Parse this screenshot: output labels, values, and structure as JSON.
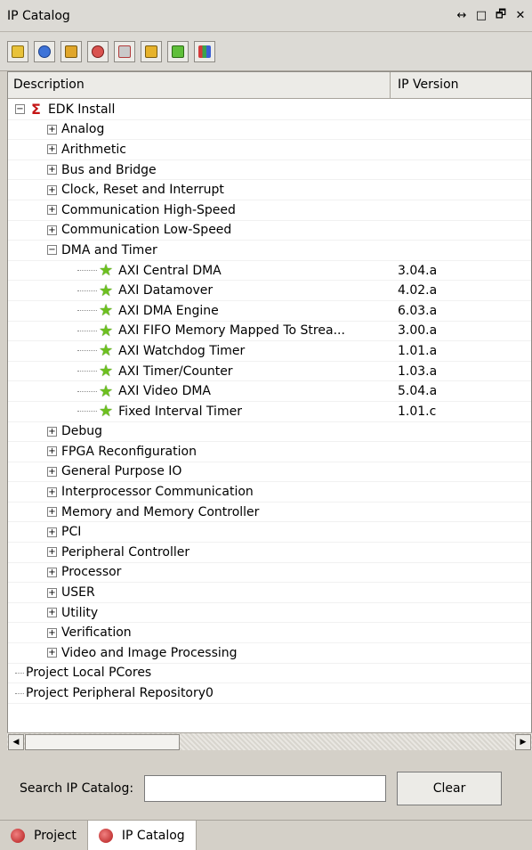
{
  "window": {
    "title": "IP Catalog",
    "controls": [
      "↔",
      "□",
      "🗗",
      "✕"
    ]
  },
  "toolbar": {
    "icons": [
      "tree-icon",
      "add-icon",
      "import-icon",
      "refresh-icon",
      "filter-icon",
      "lock-icon",
      "config-icon",
      "chart-icon"
    ]
  },
  "table": {
    "headers": [
      "Description",
      "IP Version"
    ],
    "rows": [
      {
        "label": "EDK Install",
        "level": 0,
        "exp": "minus",
        "kind": "root",
        "ver": ""
      },
      {
        "label": "Analog",
        "level": 1,
        "exp": "plus",
        "ver": ""
      },
      {
        "label": "Arithmetic",
        "level": 1,
        "exp": "plus",
        "ver": ""
      },
      {
        "label": "Bus and Bridge",
        "level": 1,
        "exp": "plus",
        "ver": ""
      },
      {
        "label": "Clock, Reset and Interrupt",
        "level": 1,
        "exp": "plus",
        "ver": ""
      },
      {
        "label": "Communication High-Speed",
        "level": 1,
        "exp": "plus",
        "ver": ""
      },
      {
        "label": "Communication Low-Speed",
        "level": 1,
        "exp": "plus",
        "ver": ""
      },
      {
        "label": "DMA and Timer",
        "level": 1,
        "exp": "minus",
        "ver": ""
      },
      {
        "label": "AXI Central DMA",
        "level": 2,
        "kind": "star",
        "ver": "3.04.a"
      },
      {
        "label": "AXI Datamover",
        "level": 2,
        "kind": "star",
        "ver": "4.02.a"
      },
      {
        "label": "AXI DMA Engine",
        "level": 2,
        "kind": "star",
        "ver": "6.03.a"
      },
      {
        "label": "AXI FIFO Memory Mapped To Strea...",
        "level": 2,
        "kind": "star",
        "ver": "3.00.a"
      },
      {
        "label": "AXI Watchdog Timer",
        "level": 2,
        "kind": "star",
        "ver": "1.01.a"
      },
      {
        "label": "AXI Timer/Counter",
        "level": 2,
        "kind": "star",
        "ver": "1.03.a"
      },
      {
        "label": "AXI Video DMA",
        "level": 2,
        "kind": "star",
        "ver": "5.04.a"
      },
      {
        "label": "Fixed Interval Timer",
        "level": 2,
        "kind": "star",
        "ver": "1.01.c"
      },
      {
        "label": "Debug",
        "level": 1,
        "exp": "plus",
        "ver": ""
      },
      {
        "label": "FPGA Reconfiguration",
        "level": 1,
        "exp": "plus",
        "ver": ""
      },
      {
        "label": "General Purpose IO",
        "level": 1,
        "exp": "plus",
        "ver": ""
      },
      {
        "label": "Interprocessor Communication",
        "level": 1,
        "exp": "plus",
        "ver": ""
      },
      {
        "label": "Memory and Memory Controller",
        "level": 1,
        "exp": "plus",
        "ver": ""
      },
      {
        "label": "PCI",
        "level": 1,
        "exp": "plus",
        "ver": ""
      },
      {
        "label": "Peripheral Controller",
        "level": 1,
        "exp": "plus",
        "ver": ""
      },
      {
        "label": "Processor",
        "level": 1,
        "exp": "plus",
        "ver": ""
      },
      {
        "label": "USER",
        "level": 1,
        "exp": "plus",
        "ver": ""
      },
      {
        "label": "Utility",
        "level": 1,
        "exp": "plus",
        "ver": ""
      },
      {
        "label": "Verification",
        "level": 1,
        "exp": "plus",
        "ver": ""
      },
      {
        "label": "Video and Image Processing",
        "level": 1,
        "exp": "plus",
        "ver": ""
      },
      {
        "label": "Project Local PCores",
        "level": 0,
        "kind": "leaf",
        "ver": ""
      },
      {
        "label": "Project Peripheral Repository0",
        "level": 0,
        "kind": "leaf",
        "ver": ""
      }
    ]
  },
  "search": {
    "label": "Search IP Catalog:",
    "value": "",
    "clear_label": "Clear"
  },
  "tabs": [
    {
      "label": "Project",
      "active": false
    },
    {
      "label": "IP Catalog",
      "active": true
    }
  ]
}
